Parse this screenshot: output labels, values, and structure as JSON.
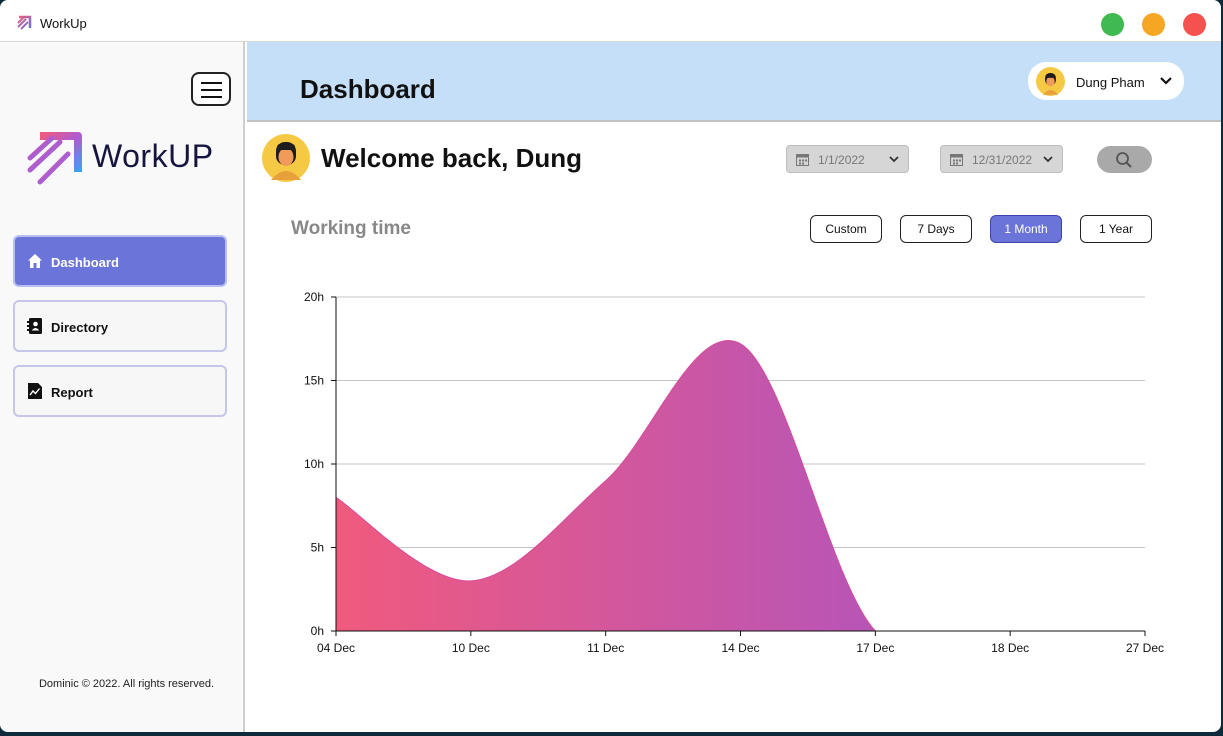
{
  "window": {
    "title": "WorkUp",
    "controls": [
      "maximize",
      "minimize",
      "close"
    ],
    "control_colors": {
      "green": "#3fb950",
      "yellow": "#f5a623",
      "red": "#f4514f"
    }
  },
  "sidebar": {
    "logo_text": "WorkUP",
    "items": [
      {
        "label": "Dashboard",
        "icon": "home-icon",
        "active": true
      },
      {
        "label": "Directory",
        "icon": "contacts-book-icon",
        "active": false
      },
      {
        "label": "Report",
        "icon": "report-file-icon",
        "active": false
      }
    ],
    "copyright": "Dominic © 2022. All rights reserved."
  },
  "header": {
    "title": "Dashboard",
    "user_name": "Dung Pham"
  },
  "main": {
    "welcome": "Welcome back, Dung",
    "date_from": "1/1/2022",
    "date_to": "12/31/2022",
    "section_title": "Working time",
    "range_buttons": [
      {
        "label": "Custom",
        "active": false
      },
      {
        "label": "7 Days",
        "active": false
      },
      {
        "label": "1 Month",
        "active": true
      },
      {
        "label": "1 Year",
        "active": false
      }
    ]
  },
  "colors": {
    "accent": "#6b74d9",
    "header_bg": "#c6dff9",
    "gradient_start": "#f05a7e",
    "gradient_end": "#9b52d4"
  },
  "chart_data": {
    "type": "area",
    "title": "",
    "xlabel": "",
    "ylabel": "",
    "x_ticks": [
      "04 Dec",
      "10 Dec",
      "11 Dec",
      "14 Dec",
      "17 Dec",
      "18 Dec",
      "27 Dec"
    ],
    "y_ticks": [
      "0h",
      "5h",
      "10h",
      "15h",
      "20h"
    ],
    "ylim": [
      0,
      20
    ],
    "grid": true,
    "series": [
      {
        "values": [
          8.0,
          3.0,
          9.0,
          17.2,
          0.0,
          0.0,
          0.0
        ]
      }
    ]
  }
}
